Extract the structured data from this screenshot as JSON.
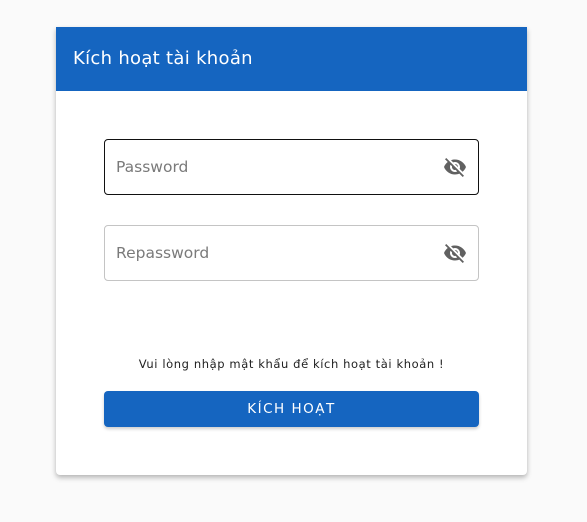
{
  "card": {
    "title": "Kích hoạt tài khoản"
  },
  "form": {
    "password": {
      "placeholder": "Password",
      "value": "",
      "toggle_icon": "eye-off-icon"
    },
    "repassword": {
      "placeholder": "Repassword",
      "value": "",
      "toggle_icon": "eye-off-icon"
    },
    "hint": "Vui lòng nhập mật khẩu để kích hoạt tài khoản !",
    "submit_label": "KÍCH HOẠT"
  },
  "colors": {
    "primary": "#1565c0",
    "background": "#fafafa",
    "card": "#ffffff",
    "icon": "#616161"
  }
}
